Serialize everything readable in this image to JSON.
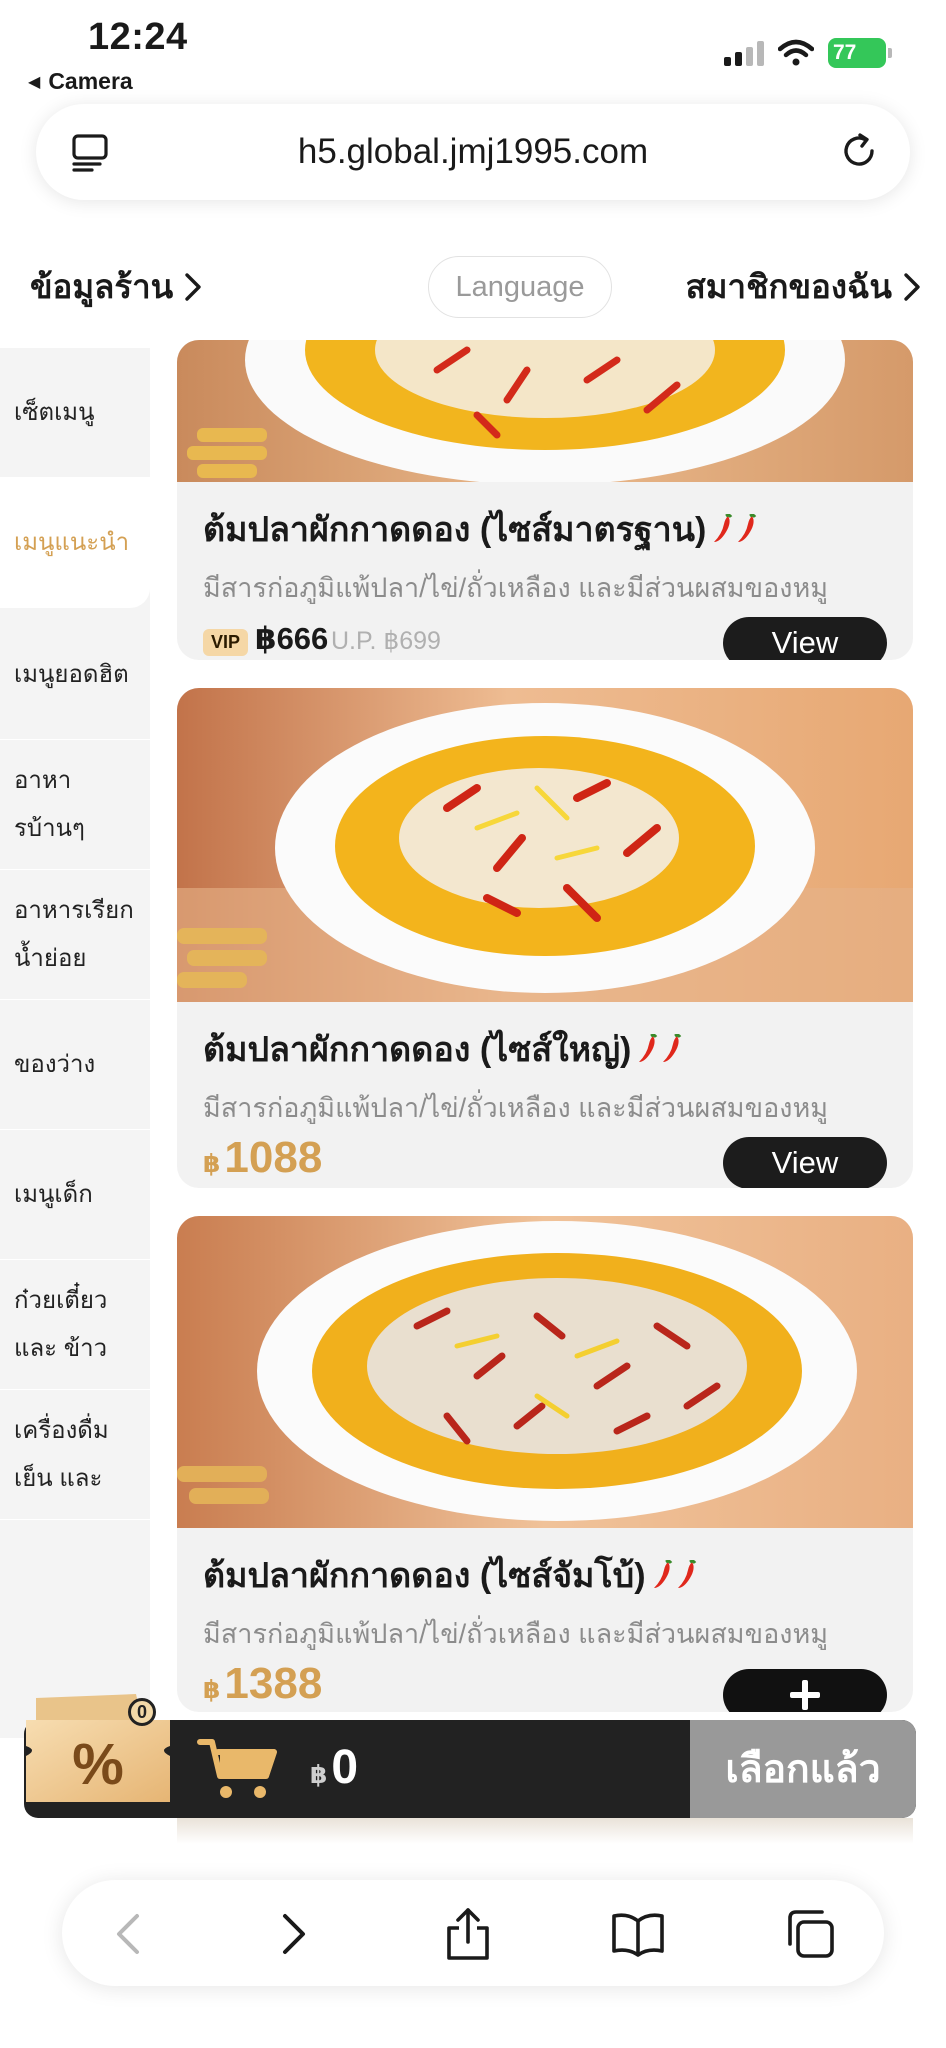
{
  "status_bar": {
    "time": "12:24",
    "back_app": "Camera",
    "battery": "77"
  },
  "browser": {
    "url": "h5.global.jmj1995.com"
  },
  "header": {
    "store_info": "ข้อมูลร้าน",
    "language": "Language",
    "my_member": "สมาชิกของฉัน"
  },
  "sidebar": {
    "items": [
      {
        "label": "เซ็ตเมนู"
      },
      {
        "label": "เมนูแนะนำ",
        "active": true
      },
      {
        "label": "เมนูยอดฮิต"
      },
      {
        "label": "อาหา รบ้านๆ"
      },
      {
        "label": "อาหารเรียก น้ำย่อย"
      },
      {
        "label": "ของว่าง"
      },
      {
        "label": "เมนูเด็ก"
      },
      {
        "label": "ก๋วยเตี๋ยว และ ข้าว"
      },
      {
        "label": "เครื่องดื่ม เย็น และ"
      }
    ]
  },
  "items": [
    {
      "title": "ต้มปลาผักกาดดอง (ไซส์มาตรฐาน)",
      "desc": "มีสารก่อภูมิแพ้ปลา/ไข่/ถั่วเหลือง และมีส่วนผสมของหมู",
      "vip_label": "VIP",
      "vip_price": "฿666",
      "original_price": "U.P. ฿699",
      "button": "View"
    },
    {
      "title": "ต้มปลาผักกาดดอง (ไซส์ใหญ่)",
      "desc": "มีสารก่อภูมิแพ้ปลา/ไข่/ถั่วเหลือง และมีส่วนผสมของหมู",
      "currency": "฿",
      "price": "1088",
      "button": "View"
    },
    {
      "title": "ต้มปลาผักกาดดอง (ไซส์จัมโบ้)",
      "desc": "มีสารก่อภูมิแพ้ปลา/ไข่/ถั่วเหลือง และมีส่วนผสมของหมู",
      "currency": "฿",
      "price": "1388",
      "button_icon": "plus-icon"
    }
  ],
  "cart": {
    "coupon_symbol": "%",
    "coupon_count": "0",
    "currency": "฿",
    "total": "0",
    "checkout": "เลือกแล้ว"
  },
  "colors": {
    "accent_gold": "#d4a053",
    "dark": "#222222",
    "checkout_gray": "#999999",
    "sidebar_bg": "#f4f4f4"
  }
}
